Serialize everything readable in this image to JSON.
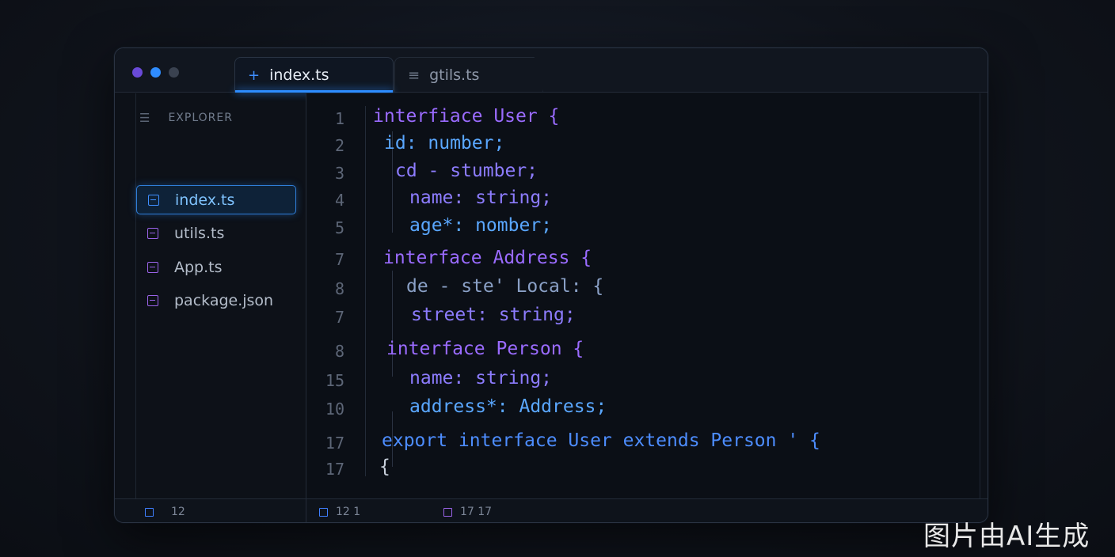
{
  "window": {
    "tabs": [
      {
        "icon": "plus-icon",
        "label": "index.ts",
        "active": true
      },
      {
        "icon": "list-icon",
        "label": "gtils.ts",
        "active": false
      }
    ]
  },
  "sidebar": {
    "header": "EXPLORER",
    "files": [
      {
        "label": "index.ts",
        "selected": true
      },
      {
        "label": "utils.ts",
        "selected": false
      },
      {
        "label": "App.ts",
        "selected": false
      },
      {
        "label": "package.json",
        "selected": false
      }
    ]
  },
  "editor": {
    "line_numbers": [
      "1",
      "2",
      "3",
      "4",
      "5",
      "7",
      "8",
      "7",
      "8",
      "15",
      "10",
      "17",
      "17"
    ],
    "lines": [
      "interfiace User {",
      "id: number;",
      "cd - stumber;",
      "name: string;",
      "age*: nomber;",
      "interface Address {",
      "de - ste' Local: {",
      "street: string;",
      "interface Person {",
      "name: string;",
      "address*: Address;",
      "export interface User extends Person ' {",
      "{"
    ]
  },
  "statusbar": {
    "left": "12",
    "middle": "12 1",
    "right": "17  17"
  },
  "watermark": "图片由AI生成",
  "colors": {
    "accent_blue": "#2f8cff",
    "accent_purple": "#9a63e8",
    "background": "#0b0f16"
  }
}
